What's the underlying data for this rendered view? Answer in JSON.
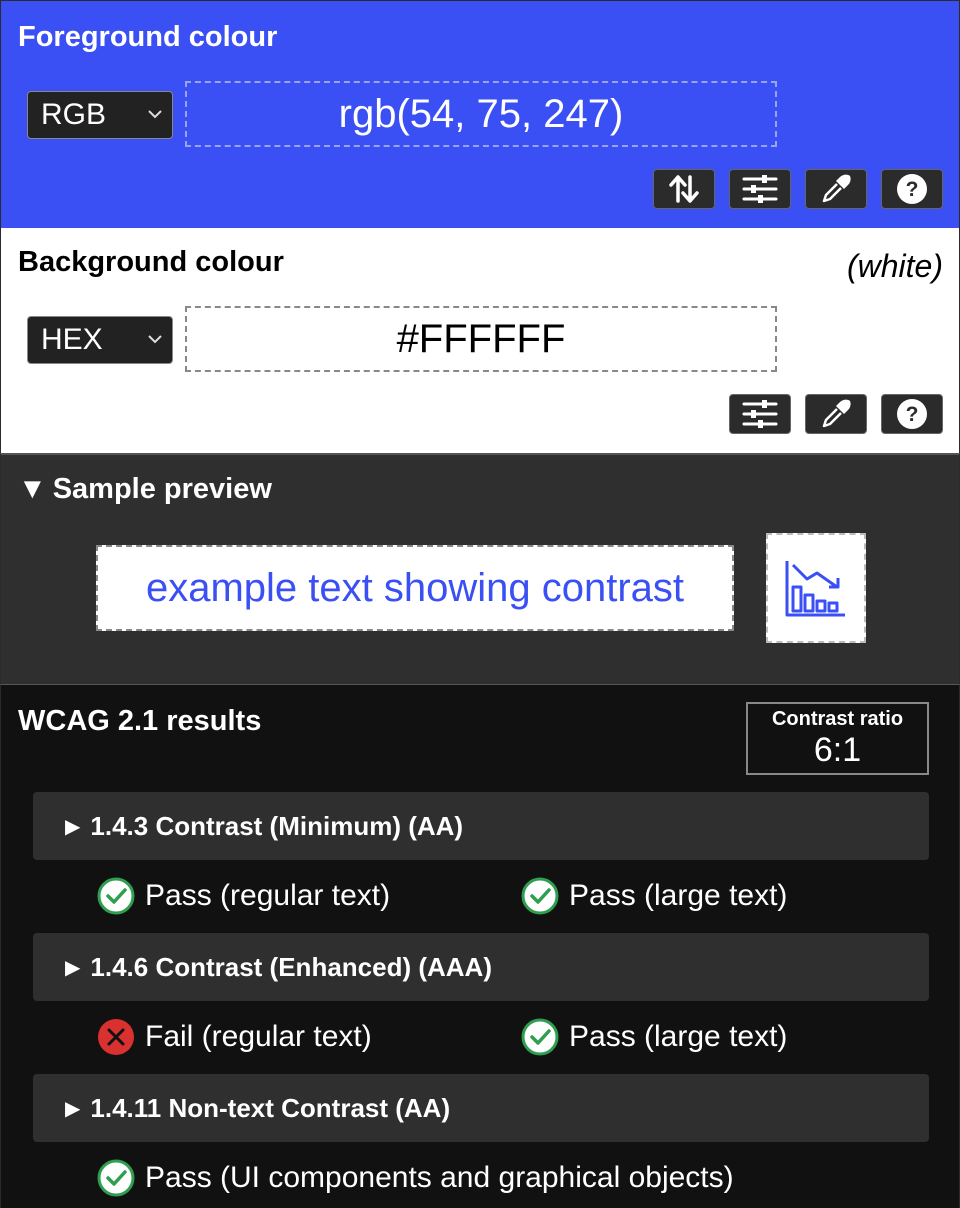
{
  "foreground": {
    "title": "Foreground colour",
    "format": "RGB",
    "value": "rgb(54, 75, 247)",
    "accent": "#3a4ff4",
    "tools": [
      "swap-icon",
      "sliders-icon",
      "eyedropper-icon",
      "help-icon"
    ]
  },
  "background": {
    "title": "Background colour",
    "colour_name": "(white)",
    "format": "HEX",
    "value": "#FFFFFF",
    "tools": [
      "sliders-icon",
      "eyedropper-icon",
      "help-icon"
    ]
  },
  "preview": {
    "title": "Sample preview",
    "toggle": "▼",
    "sample_text": "example text showing contrast",
    "icon": "chart-decline-icon"
  },
  "results": {
    "title": "WCAG 2.1 results",
    "ratio_label": "Contrast ratio",
    "ratio_value": "6:1",
    "criteria": [
      {
        "label": "1.4.3 Contrast (Minimum) (AA)",
        "results": [
          {
            "status": "pass",
            "text": "Pass (regular text)"
          },
          {
            "status": "pass",
            "text": "Pass (large text)"
          }
        ]
      },
      {
        "label": "1.4.6 Contrast (Enhanced) (AAA)",
        "results": [
          {
            "status": "fail",
            "text": "Fail (regular text)"
          },
          {
            "status": "pass",
            "text": "Pass (large text)"
          }
        ]
      },
      {
        "label": "1.4.11 Non-text Contrast (AA)",
        "results": [
          {
            "status": "pass",
            "text": "Pass (UI components and graphical objects)"
          }
        ]
      }
    ],
    "colors": {
      "pass": "#2e9e4f",
      "fail": "#d93030"
    }
  }
}
